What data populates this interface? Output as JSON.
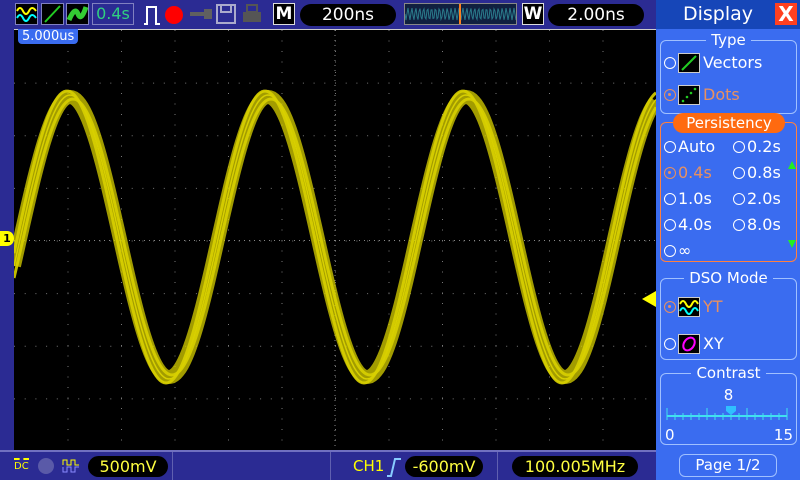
{
  "topbar": {
    "persist_value": "0.4s",
    "mode_label": "M",
    "timebase": "200ns",
    "window_label": "W",
    "window_value": "2.00ns"
  },
  "screen": {
    "trigger_pos": "5.000us",
    "channel_marker": "1"
  },
  "bottom": {
    "coupling": "DC",
    "ch_scale": "500mV",
    "trigger_source": "CH1",
    "trigger_level": "-600mV",
    "frequency": "100.005MHz"
  },
  "panel": {
    "title": "Display",
    "close": "X",
    "type": {
      "label": "Type",
      "options": [
        "Vectors",
        "Dots"
      ],
      "selected": "Dots"
    },
    "persistency": {
      "label": "Persistency",
      "options": [
        "Auto",
        "0.2s",
        "0.4s",
        "0.8s",
        "1.0s",
        "2.0s",
        "4.0s",
        "8.0s",
        "∞"
      ],
      "selected": "0.4s"
    },
    "dso_mode": {
      "label": "DSO Mode",
      "options": [
        "YT",
        "XY"
      ],
      "selected": "YT"
    },
    "contrast": {
      "label": "Contrast",
      "value": "8",
      "min": "0",
      "max": "15",
      "level": 8
    },
    "page": "Page 1/2"
  },
  "colors": {
    "trace": "#d8d000",
    "accent": "#ff6a10",
    "panel": "#3a6cf0"
  }
}
